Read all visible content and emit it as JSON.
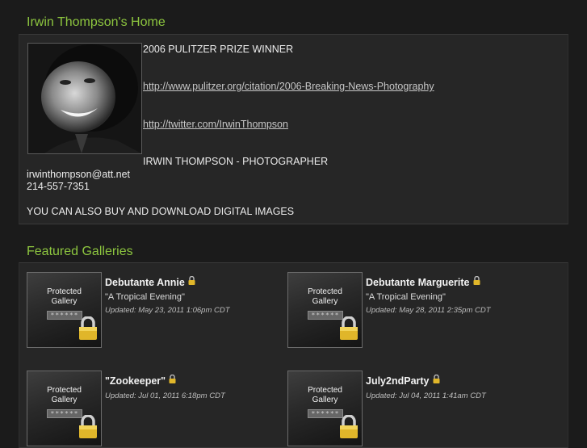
{
  "home": {
    "title": "Irwin Thompson's Home",
    "bio": {
      "headline": "2006 PULITZER PRIZE WINNER",
      "link1": "http://www.pulitzer.org/citation/2006-Breaking-News-Photography",
      "link2": "http://twitter.com/IrwinThompson",
      "role": "IRWIN THOMPSON - PHOTOGRAPHER",
      "email": "irwinthompson@att.net",
      "phone": "214-557-7351",
      "note": "YOU CAN ALSO BUY AND DOWNLOAD DIGITAL IMAGES"
    }
  },
  "featured": {
    "title": "Featured Galleries",
    "thumb_text_line1": "Protected",
    "thumb_text_line2": "Gallery",
    "thumb_mask": "******",
    "galleries": [
      {
        "name": "Debutante Annie",
        "subtitle": "\"A Tropical Evening\"",
        "updated": "Updated: May 23, 2011 1:06pm CDT",
        "icon": "lock-icon"
      },
      {
        "name": "Debutante Marguerite",
        "subtitle": "\"A Tropical Evening\"",
        "updated": "Updated: May 28, 2011 2:35pm CDT",
        "icon": "lock-icon"
      },
      {
        "name": "\"Zookeeper\"",
        "subtitle": "",
        "updated": "Updated: Jul 01, 2011 6:18pm CDT",
        "icon": "lock-icon"
      },
      {
        "name": "July2ndParty",
        "subtitle": "",
        "updated": "Updated: Jul 04, 2011 1:41am CDT",
        "icon": "lock-icon"
      }
    ]
  },
  "colors": {
    "accent": "#8dc63f",
    "background": "#1b1b1b",
    "panel": "#262626",
    "lock": "#e0b62a"
  }
}
